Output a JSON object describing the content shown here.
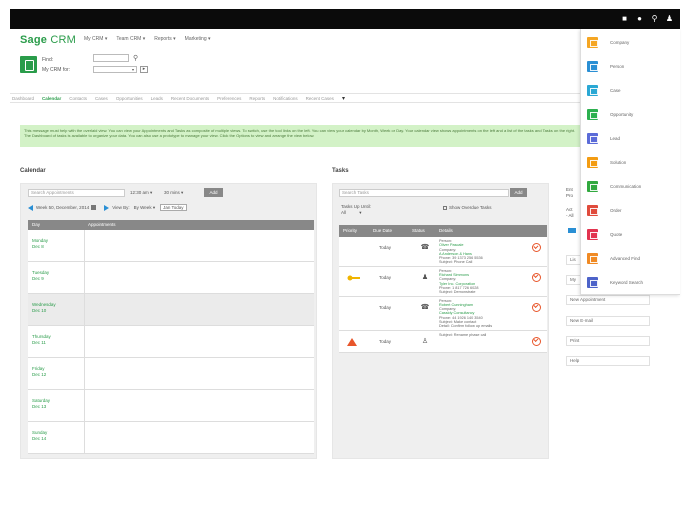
{
  "app": {
    "logo_bold": "Sage",
    "logo_light": "CRM"
  },
  "topbar": {
    "icons": [
      "chat-icon",
      "help-icon",
      "search-icon",
      "user-icon"
    ]
  },
  "topnav": [
    "My CRM ▾",
    "Team CRM ▾",
    "Reports ▾",
    "Marketing ▾"
  ],
  "finder": {
    "find_label": "Find:",
    "my_crm_label": "My CRM for:",
    "select_value": "▾",
    "button": "▸"
  },
  "tabs": {
    "items": [
      "Dashboard",
      "Calendar",
      "Contacts",
      "Cases",
      "Opportunities",
      "Leads",
      "Recent Documents",
      "Preferences",
      "Reports",
      "Notifications",
      "Recent Cases"
    ],
    "active_index": 1,
    "more": "▾"
  },
  "banner": {
    "text": "This message must help with the overlaid view. You can view your Appointments and Tasks as composite of multiple views. To switch, use the tool links on the left. You can view your calendar by Month, Week or Day. Your calendar view shows appointments on the left and a list of the tasks and Tasks on the right. The Dashboard of tasks is available to organize your data. You can also use a prototype to manage your view. Click the Options to view and arrange the view below."
  },
  "calendar": {
    "title": "Calendar",
    "search_placeholder": "Search Appointments",
    "time_select": "12:30 am ▾",
    "duration_select": "30 mins ▾",
    "add_label": "Add",
    "week_label": "Week 50, December, 2014",
    "view_by": "View By:",
    "view_by_value": "By Week ▾",
    "today_label": "Jan Today",
    "col_day": "Day",
    "col_appointments": "Appointments",
    "days": [
      {
        "name": "Monday",
        "date": "Dec 8"
      },
      {
        "name": "Tuesday",
        "date": "Dec 9"
      },
      {
        "name": "Wednesday",
        "date": "Dec 10"
      },
      {
        "name": "Thursday",
        "date": "Dec 11"
      },
      {
        "name": "Friday",
        "date": "Dec 12"
      },
      {
        "name": "Saturday",
        "date": "Dec 13"
      },
      {
        "name": "Sunday",
        "date": "Dec 14"
      }
    ],
    "highlight_index": 2
  },
  "tasks": {
    "title": "Tasks",
    "search_placeholder": "Search Tasks",
    "add_label": "Add",
    "filter_label": "Tasks Up Until:",
    "filter_value": "All",
    "filter_dd": "▾",
    "checkbox_label": "Show Overdue Tasks",
    "col_priority": "Priority",
    "col_due": "Due Date",
    "col_status": "Status",
    "col_details": "Details",
    "rows": [
      {
        "priority": "none",
        "due": "Today",
        "status_icon": "phone-icon",
        "status_glyph": "☎",
        "details": [
          "Person:",
          "Oliver Pascale",
          "Company:",
          "A Anderson & Hans",
          "Phone: 39 1373 256 5536",
          "Subject: Phone Call"
        ],
        "link_lines": [
          1,
          3
        ]
      },
      {
        "priority": "medium",
        "due": "Today",
        "status_icon": "meeting-icon",
        "status_glyph": "♟",
        "details": [
          "Person:",
          "Richard Simmons",
          "Company:",
          "Tyler Inc. Corporation",
          "Phone: 1 817 726 6028",
          "Subject: Demonstrate"
        ],
        "link_lines": [
          1,
          3
        ]
      },
      {
        "priority": "none",
        "due": "Today",
        "status_icon": "phone-icon",
        "status_glyph": "☎",
        "details": [
          "Person:",
          "Robert Cunningham",
          "Company:",
          "Cassidy Consultancy",
          "Phone: 44 1926 140 3540",
          "Subject: Make contact",
          "Detail: Confirm follow up emails"
        ],
        "link_lines": [
          1,
          3
        ]
      },
      {
        "priority": "high",
        "due": "Today",
        "status_icon": "user-icon",
        "status_glyph": "♙",
        "details": [
          "Subject: Rename phase call"
        ],
        "link_lines": []
      }
    ],
    "priority_colors": {
      "none": "",
      "medium": "#f0b400",
      "high": "#e8562b"
    }
  },
  "sidebar": {
    "frag1": "Ent",
    "frag2": "Pro",
    "frag3": "Act",
    "frag4": "- All",
    "buttons": [
      "Lis",
      "My",
      "New Appointment",
      "New E-mail",
      "Print",
      "Help"
    ]
  },
  "new_menu": {
    "items": [
      {
        "label": "Company",
        "color": "#f5a623",
        "icon": "company-icon"
      },
      {
        "label": "Person",
        "color": "#2a8fd4",
        "icon": "person-icon"
      },
      {
        "label": "Case",
        "color": "#2aa8d4",
        "icon": "case-icon"
      },
      {
        "label": "Opportunity",
        "color": "#2cb04f",
        "icon": "opportunity-icon"
      },
      {
        "label": "Lead",
        "color": "#5b6bd8",
        "icon": "lead-icon"
      },
      {
        "label": "Solution",
        "color": "#f39c12",
        "icon": "solution-icon"
      },
      {
        "label": "Communication",
        "color": "#31a93f",
        "icon": "communication-icon"
      },
      {
        "label": "Order",
        "color": "#e04b3c",
        "icon": "order-icon"
      },
      {
        "label": "Quote",
        "color": "#e2334f",
        "icon": "quote-icon"
      },
      {
        "label": "Advanced Find",
        "color": "#f08a24",
        "icon": "advanced-find-icon"
      },
      {
        "label": "Keyword Search",
        "color": "#4d63c9",
        "icon": "keyword-search-icon"
      }
    ]
  }
}
